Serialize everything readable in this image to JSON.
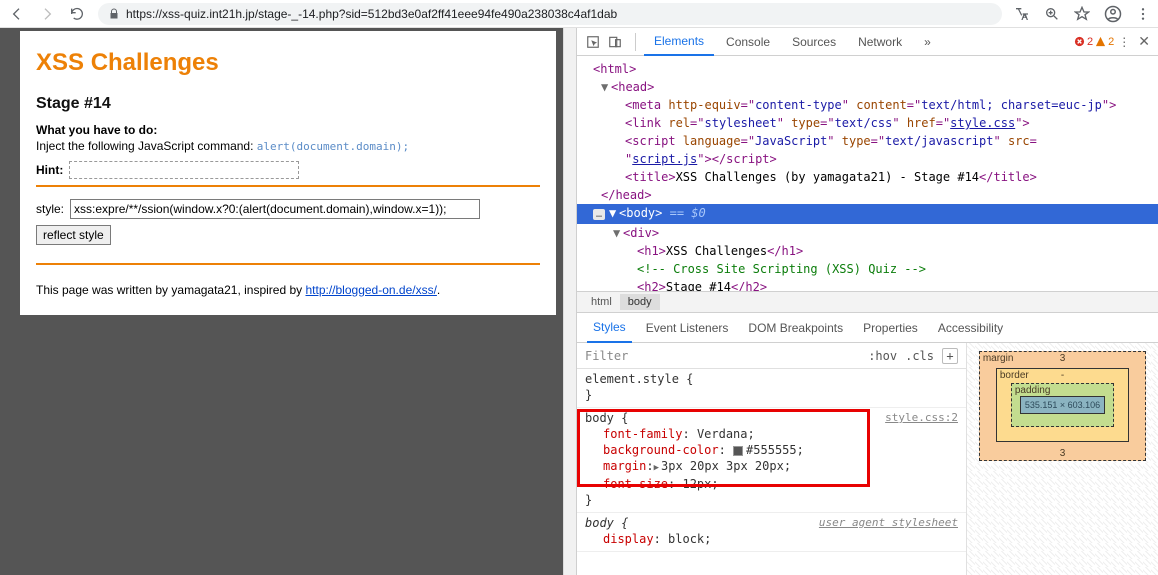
{
  "browser": {
    "url": "https://xss-quiz.int21h.jp/stage-_-14.php?sid=512bd3e0af2ff41eee94fe490a238038c4af1dab"
  },
  "page": {
    "h1": "XSS Challenges",
    "h2": "Stage #14",
    "what_label": "What you have to do:",
    "inject_prefix": "Inject the following JavaScript command: ",
    "inject_code": "alert(document.domain);",
    "hint_label": "Hint:",
    "style_label": "style:",
    "style_value": "xss:expre/**/ssion(window.x?0:(alert(document.domain),window.x=1));",
    "reflect_btn": "reflect style",
    "footer_prefix": "This page was written by yamagata21, inspired by ",
    "footer_link": "http://blogged-on.de/xss/",
    "footer_suffix": "."
  },
  "devtools": {
    "tabs": {
      "elements": "Elements",
      "console": "Console",
      "sources": "Sources",
      "network": "Network"
    },
    "errors": "2",
    "warnings": "2",
    "dom": {
      "html_open": "<html>",
      "head_open": "<head>",
      "meta": {
        "he": "http-equiv",
        "hev": "content-type",
        "c": "content",
        "cv": "text/html; charset=euc-jp"
      },
      "link": {
        "rel": "rel",
        "relv": "stylesheet",
        "type": "type",
        "typev": "text/css",
        "href": "href",
        "hrefv": "style.css"
      },
      "script": {
        "lang": "language",
        "langv": "JavaScript",
        "type": "type",
        "typev": "text/javascript",
        "src": "src",
        "srcv": "script.js"
      },
      "title_text": "XSS Challenges (by yamagata21) - Stage #14",
      "head_close": "</head>",
      "body_sel": "<body>",
      "body_eq": " == $0",
      "div_open": "<div>",
      "h1_text": "XSS Challenges",
      "comment": "<!-- Cross Site Scripting (XSS) Quiz -->",
      "h2_text": "Stage #14"
    },
    "crumbs": {
      "c1": "html",
      "c2": "body"
    },
    "styles_tabs": {
      "styles": "Styles",
      "ev": "Event Listeners",
      "dom": "DOM Breakpoints",
      "props": "Properties",
      "acc": "Accessibility"
    },
    "filter": {
      "ph": "Filter",
      "hov": ":hov",
      "cls": ".cls"
    },
    "rules": {
      "r1_sel": "element.style",
      "r2_src": "style.css:2",
      "r2_sel": "body",
      "r2_p1n": "font-family",
      "r2_p1v": "Verdana",
      "r2_p2n": "background-color",
      "r2_p2v": "#555555",
      "r2_p3n": "margin",
      "r2_p3v": "3px 20px 3px 20px",
      "r2_p4n": "font-size",
      "r2_p4v": "12px",
      "r3_ua": "user agent stylesheet",
      "r3_sel": "body",
      "r3_p1n": "display",
      "r3_p1v": "block"
    },
    "box": {
      "margin": "margin",
      "border": "border",
      "padding": "padding",
      "content": "535.151 × 603.106",
      "m_t": "3",
      "m_r": "-",
      "m_b": "3",
      "m_l": "-",
      "b": "-",
      "p": "-"
    }
  }
}
